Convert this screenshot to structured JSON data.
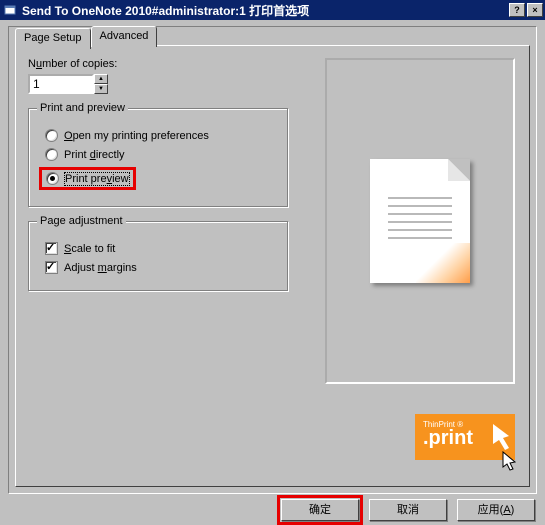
{
  "window": {
    "title": "Send To OneNote 2010#administrator:1 打印首选项"
  },
  "tabs": {
    "page_setup": "Page Setup",
    "advanced": "Advanced"
  },
  "copies": {
    "label_pre": "N",
    "label_under": "u",
    "label_post": "mber of copies:",
    "value": "1"
  },
  "print_preview_group": {
    "legend": "Print and preview",
    "open_pref": {
      "pre": "",
      "u": "O",
      "post": "pen my printing preferences"
    },
    "print_directly": {
      "pre": "Print ",
      "u": "d",
      "post": "irectly"
    },
    "print_preview": {
      "pre": "Print pre",
      "u": "v",
      "post": "iew"
    },
    "selected": "print_preview"
  },
  "page_adj_group": {
    "legend": "Page adjustment",
    "scale": {
      "u": "S",
      "post": "cale to fit",
      "checked": true
    },
    "margins": {
      "pre": "Adjust ",
      "u": "m",
      "post": "argins",
      "checked": true
    }
  },
  "badge": {
    "small": "ThinPrint ®",
    "big": ".print"
  },
  "buttons": {
    "ok": "确定",
    "cancel": "取消",
    "apply_pre": "应用(",
    "apply_u": "A",
    "apply_post": ")"
  }
}
